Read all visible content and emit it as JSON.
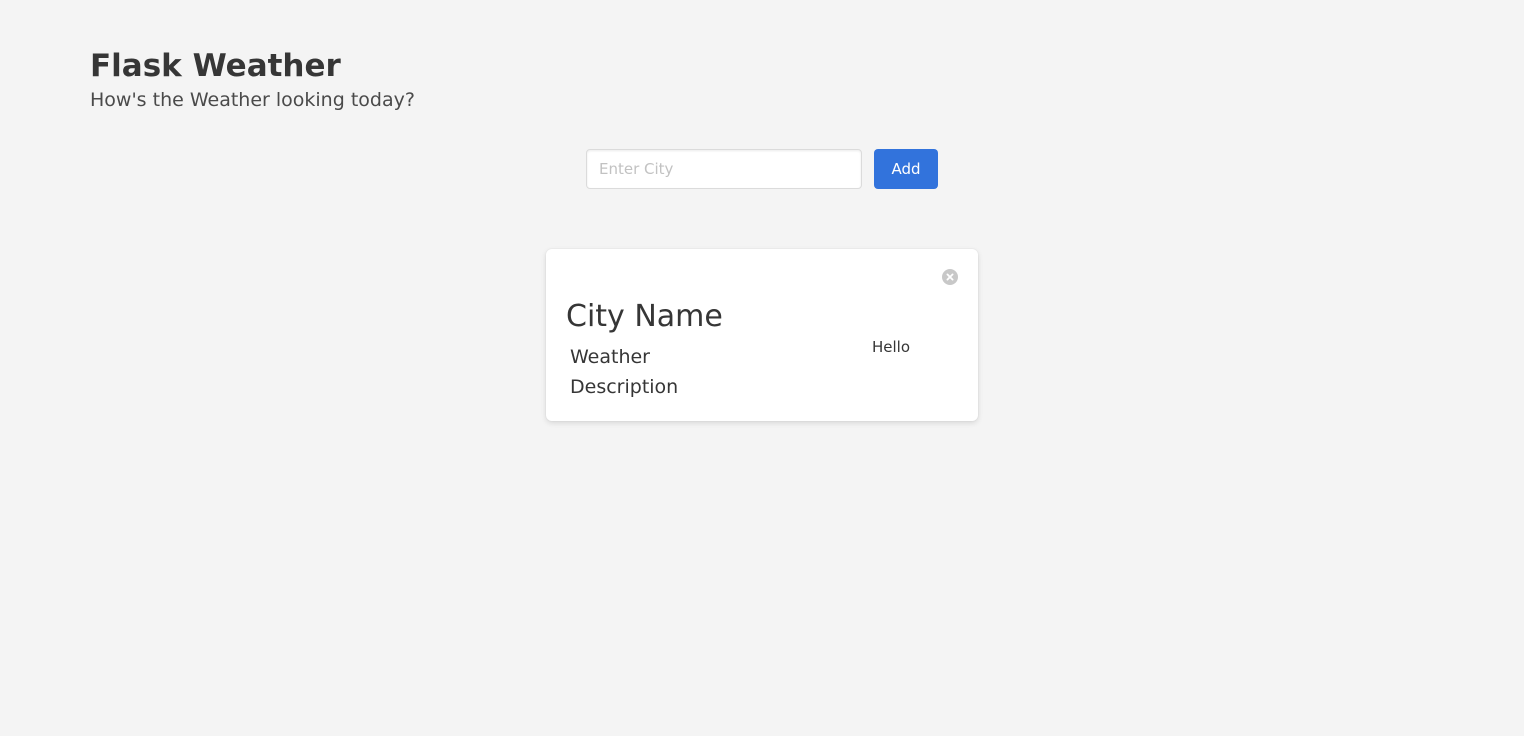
{
  "hero": {
    "title": "Flask Weather",
    "subtitle": "How's the Weather looking today?"
  },
  "search": {
    "value": "",
    "placeholder": "Enter City",
    "button_label": "Add"
  },
  "weather_card": {
    "city_name": "City Name",
    "description": "Weather Description",
    "extra_text": "Hello",
    "delete_icon": "close-circle-icon"
  },
  "colors": {
    "background": "#f4f4f4",
    "accent": "#3273dc",
    "text": "#363636",
    "card": "#ffffff",
    "icon": "#c8c8c8"
  }
}
